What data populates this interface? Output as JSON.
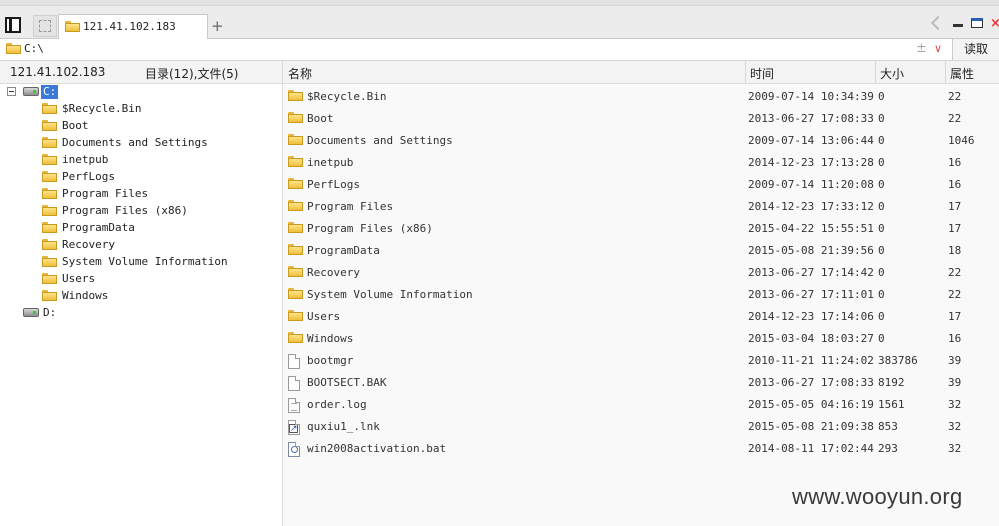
{
  "tabs": [
    {
      "label": "121.41.102.183"
    }
  ],
  "address": {
    "path": "C:\\",
    "pm_symbol": "±",
    "dropdown_symbol": "∨",
    "read_label": "读取"
  },
  "window_controls": {
    "close_symbol": "×"
  },
  "left_header": {
    "host": "121.41.102.183",
    "summary": "目录(12),文件(5)"
  },
  "columns": {
    "name": "名称",
    "time": "时间",
    "size": "大小",
    "attr": "属性"
  },
  "tree": {
    "drive_c": "C:",
    "children": [
      "$Recycle.Bin",
      "Boot",
      "Documents and Settings",
      "inetpub",
      "PerfLogs",
      "Program Files",
      "Program Files (x86)",
      "ProgramData",
      "Recovery",
      "System Volume Information",
      "Users",
      "Windows"
    ],
    "drive_d": "D:"
  },
  "files": [
    {
      "icon": "folder",
      "name": "$Recycle.Bin",
      "time": "2009-07-14 10:34:39",
      "size": "0",
      "attr": "22"
    },
    {
      "icon": "folder",
      "name": "Boot",
      "time": "2013-06-27 17:08:33",
      "size": "0",
      "attr": "22"
    },
    {
      "icon": "folder",
      "name": "Documents and Settings",
      "time": "2009-07-14 13:06:44",
      "size": "0",
      "attr": "1046"
    },
    {
      "icon": "folder",
      "name": "inetpub",
      "time": "2014-12-23 17:13:28",
      "size": "0",
      "attr": "16"
    },
    {
      "icon": "folder",
      "name": "PerfLogs",
      "time": "2009-07-14 11:20:08",
      "size": "0",
      "attr": "16"
    },
    {
      "icon": "folder",
      "name": "Program Files",
      "time": "2014-12-23 17:33:12",
      "size": "0",
      "attr": "17"
    },
    {
      "icon": "folder",
      "name": "Program Files (x86)",
      "time": "2015-04-22 15:55:51",
      "size": "0",
      "attr": "17"
    },
    {
      "icon": "folder",
      "name": "ProgramData",
      "time": "2015-05-08 21:39:56",
      "size": "0",
      "attr": "18"
    },
    {
      "icon": "folder",
      "name": "Recovery",
      "time": "2013-06-27 17:14:42",
      "size": "0",
      "attr": "22"
    },
    {
      "icon": "folder",
      "name": "System Volume Information",
      "time": "2013-06-27 17:11:01",
      "size": "0",
      "attr": "22"
    },
    {
      "icon": "folder",
      "name": "Users",
      "time": "2014-12-23 17:14:06",
      "size": "0",
      "attr": "17"
    },
    {
      "icon": "folder",
      "name": "Windows",
      "time": "2015-03-04 18:03:27",
      "size": "0",
      "attr": "16"
    },
    {
      "icon": "file",
      "name": "bootmgr",
      "time": "2010-11-21 11:24:02",
      "size": "383786",
      "attr": "39"
    },
    {
      "icon": "file",
      "name": "BOOTSECT.BAK",
      "time": "2013-06-27 17:08:33",
      "size": "8192",
      "attr": "39"
    },
    {
      "icon": "text-file",
      "name": "order.log",
      "time": "2015-05-05 04:16:19",
      "size": "1561",
      "attr": "32"
    },
    {
      "icon": "shortcut-file",
      "name": "quxiu1_.lnk",
      "time": "2015-05-08 21:09:38",
      "size": "853",
      "attr": "32"
    },
    {
      "icon": "batch-file",
      "name": "win2008activation.bat",
      "time": "2014-08-11 17:02:44",
      "size": "293",
      "attr": "32"
    }
  ],
  "watermark": "www.wooyun.org"
}
